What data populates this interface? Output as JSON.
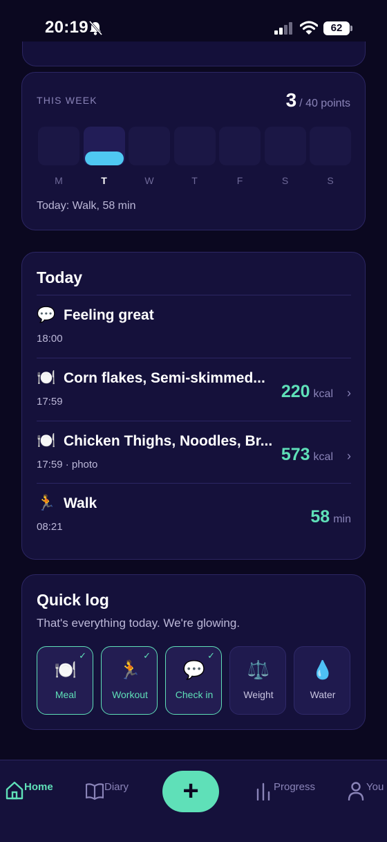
{
  "status_bar": {
    "time": "20:19",
    "battery": "62"
  },
  "this_week": {
    "label": "THIS WEEK",
    "points_value": "3",
    "points_total": "/ 40 points",
    "days": [
      {
        "letter": "M",
        "active": false,
        "progress": 0
      },
      {
        "letter": "T",
        "active": true,
        "progress": 0.35
      },
      {
        "letter": "W",
        "active": false,
        "progress": 0
      },
      {
        "letter": "T",
        "active": false,
        "progress": 0
      },
      {
        "letter": "F",
        "active": false,
        "progress": 0
      },
      {
        "letter": "S",
        "active": false,
        "progress": 0
      },
      {
        "letter": "S",
        "active": false,
        "progress": 0
      }
    ],
    "summary": "Today: Walk, 58 min",
    "bar_color": "#4fc8f2"
  },
  "today": {
    "title": "Today",
    "entries": [
      {
        "icon": "speech-bubble-icon",
        "glyph": "💬",
        "title": "Feeling great",
        "sub": "18:00",
        "value": "",
        "unit": "",
        "chevron": false
      },
      {
        "icon": "plate-icon",
        "glyph": "🍽️",
        "title": "Corn flakes, Semi-skimmed...",
        "sub": "17:59",
        "value": "220",
        "unit": "kcal",
        "chevron": true
      },
      {
        "icon": "plate-icon",
        "glyph": "🍽️",
        "title": "Chicken Thighs, Noodles, Br...",
        "sub": "17:59 · photo",
        "value": "573",
        "unit": "kcal",
        "chevron": true
      },
      {
        "icon": "runner-icon",
        "glyph": "🏃",
        "title": "Walk",
        "sub": "08:21",
        "value": "58",
        "unit": "min",
        "chevron": false
      }
    ]
  },
  "quick_log": {
    "title": "Quick log",
    "subtitle": "That's everything today. We're glowing.",
    "tiles": [
      {
        "icon": "plate-icon",
        "glyph": "🍽️",
        "label": "Meal",
        "done": true
      },
      {
        "icon": "runner-icon",
        "glyph": "🏃",
        "label": "Workout",
        "done": true
      },
      {
        "icon": "speech-bubble-icon",
        "glyph": "💬",
        "label": "Check in",
        "done": true
      },
      {
        "icon": "scale-icon",
        "glyph": "⚖️",
        "label": "Weight",
        "done": false
      },
      {
        "icon": "water-drop-icon",
        "glyph": "💧",
        "label": "Water",
        "done": false
      }
    ],
    "check_glyph": "✓"
  },
  "bottom_nav": {
    "home": "Home",
    "diary": "Diary",
    "add": "+",
    "progress": "Progress",
    "you": "You"
  },
  "colors": {
    "accent": "#5fe0b8",
    "background": "#0b0820",
    "card": "#15113b"
  }
}
